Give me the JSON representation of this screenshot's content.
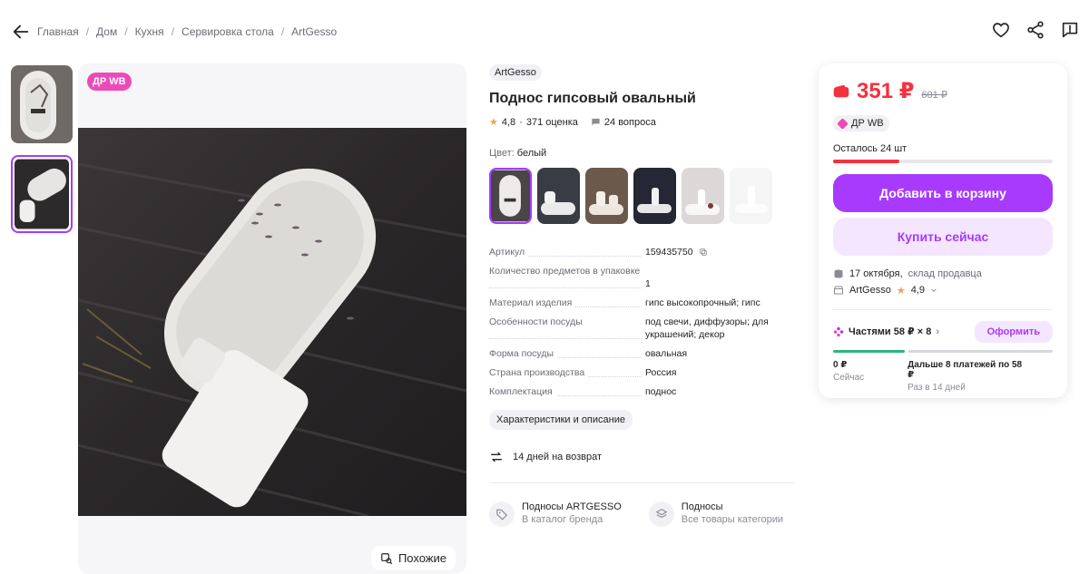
{
  "breadcrumbs": [
    "Главная",
    "Дом",
    "Кухня",
    "Сервировка стола",
    "ArtGesso"
  ],
  "badge": "ДР WB",
  "similar_label": "Похожие",
  "product": {
    "brand": "ArtGesso",
    "title": "Поднос гипсовый овальный",
    "rating": "4,8",
    "reviews": "371 оценка",
    "questions": "24 вопроса",
    "color_label": "Цвет:",
    "color_value": "белый"
  },
  "specs": [
    {
      "k": "Артикул",
      "v": "159435750"
    },
    {
      "k": "Количество предметов в упаковке",
      "v": "1"
    },
    {
      "k": "Материал изделия",
      "v": "гипс высокопрочный; гипс"
    },
    {
      "k": "Особенности посуды",
      "v": "под свечи, диффузоры; для украшений; декор"
    },
    {
      "k": "Форма посуды",
      "v": "овальная"
    },
    {
      "k": "Страна производства",
      "v": "Россия"
    },
    {
      "k": "Комплектация",
      "v": "поднос"
    }
  ],
  "characteristics_button": "Характеристики и описание",
  "return_text": "14 дней на возврат",
  "links": [
    {
      "title": "Подносы ARTGESSO",
      "sub": "В каталог бренда"
    },
    {
      "title": "Подносы",
      "sub": "Все товары категории"
    }
  ],
  "card": {
    "price": "351 ₽",
    "old_price": "601 ₽",
    "badge": "ДР WB",
    "stock": "Осталось 24 шт",
    "stock_fraction": 0.3,
    "cart_button": "Добавить в корзину",
    "buy_button": "Купить сейчас",
    "delivery_date": "17 октября,",
    "delivery_from": "склад продавца",
    "seller_name": "ArtGesso",
    "seller_rating": "4,9",
    "parts_label": "Частями 58 ₽ × 8",
    "arrange_button": "Оформить",
    "now_amount": "0 ₽",
    "now_label": "Сейчас",
    "later_amount": "Дальше 8 платежей по 58 ₽",
    "later_label": "Раз в 14 дней"
  },
  "colors": {
    "accent": "#a73afd",
    "price": "#f5313e",
    "badge": "#ec4ab8",
    "green": "#2bb67b"
  }
}
